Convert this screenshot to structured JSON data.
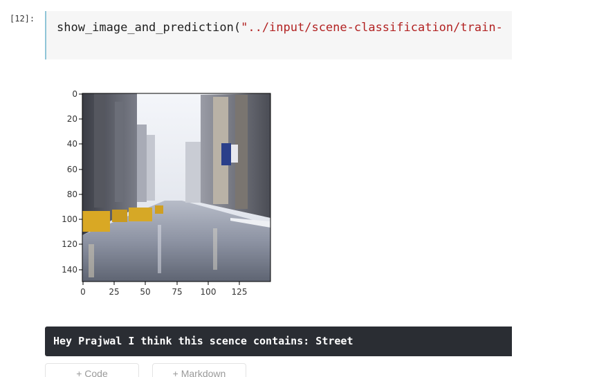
{
  "cell": {
    "prompt": "[12]:",
    "code_function": "show_image_and_prediction(",
    "code_string": "\"../input/scene-classification/train-"
  },
  "plot": {
    "y_ticks": [
      "0",
      "20",
      "40",
      "60",
      "80",
      "100",
      "120",
      "140"
    ],
    "x_ticks": [
      "0",
      "25",
      "50",
      "75",
      "100",
      "125"
    ]
  },
  "output": {
    "text": "Hey Prajwal I think this scence contains: Street"
  },
  "footer": {
    "add_code_label": "+ Code",
    "add_markdown_label": "+ Markdown"
  }
}
